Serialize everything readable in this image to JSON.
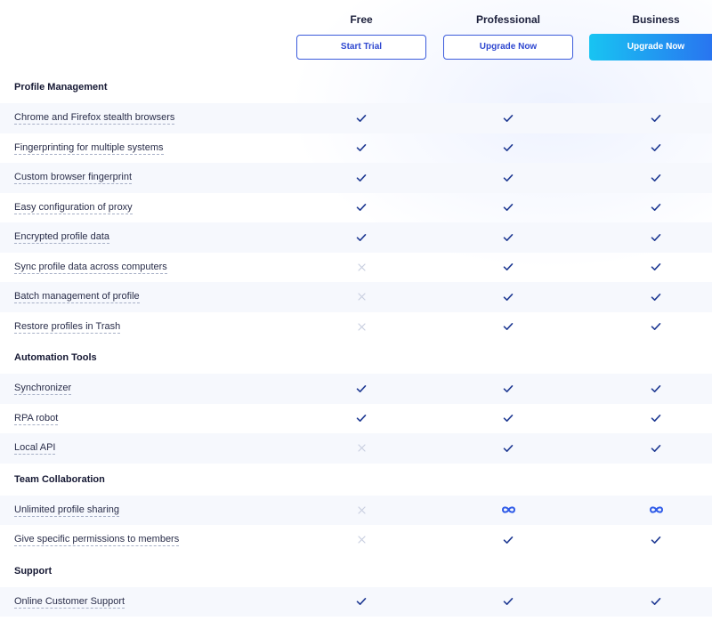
{
  "plans": [
    {
      "name": "Free",
      "button": "Start Trial",
      "style": "outline"
    },
    {
      "name": "Professional",
      "button": "Upgrade Now",
      "style": "outline"
    },
    {
      "name": "Business",
      "button": "Upgrade Now",
      "style": "primary"
    }
  ],
  "sections": [
    {
      "title": "Profile Management",
      "rows": [
        {
          "label": "Chrome and Firefox stealth browsers",
          "values": [
            "check",
            "check",
            "check"
          ]
        },
        {
          "label": "Fingerprinting for multiple systems",
          "values": [
            "check",
            "check",
            "check"
          ]
        },
        {
          "label": "Custom browser fingerprint",
          "values": [
            "check",
            "check",
            "check"
          ]
        },
        {
          "label": "Easy configuration of proxy",
          "values": [
            "check",
            "check",
            "check"
          ]
        },
        {
          "label": "Encrypted profile data",
          "values": [
            "check",
            "check",
            "check"
          ]
        },
        {
          "label": "Sync profile data across computers",
          "values": [
            "cross",
            "check",
            "check"
          ]
        },
        {
          "label": "Batch management of profile",
          "values": [
            "cross",
            "check",
            "check"
          ]
        },
        {
          "label": "Restore profiles in Trash",
          "values": [
            "cross",
            "check",
            "check"
          ]
        }
      ]
    },
    {
      "title": "Automation Tools",
      "rows": [
        {
          "label": "Synchronizer",
          "values": [
            "check",
            "check",
            "check"
          ]
        },
        {
          "label": "RPA robot",
          "values": [
            "check",
            "check",
            "check"
          ]
        },
        {
          "label": "Local API",
          "values": [
            "cross",
            "check",
            "check"
          ]
        }
      ]
    },
    {
      "title": "Team Collaboration",
      "rows": [
        {
          "label": "Unlimited profile sharing",
          "values": [
            "cross",
            "infinity",
            "infinity"
          ]
        },
        {
          "label": "Give specific permissions to members",
          "values": [
            "cross",
            "check",
            "check"
          ]
        }
      ]
    },
    {
      "title": "Support",
      "rows": [
        {
          "label": "Online Customer Support",
          "values": [
            "check",
            "check",
            "check"
          ]
        }
      ]
    }
  ],
  "icons": {
    "check": "check-icon",
    "cross": "cross-icon",
    "infinity": "infinity-icon"
  },
  "colors": {
    "accent": "#2f48d0",
    "check": "#1f3a93",
    "cross": "#c9cfe0",
    "infinity": "#2f5be8",
    "row_shade": "#f6f8fd",
    "gradient_start": "#18c4f2",
    "gradient_end": "#2a6ef0"
  }
}
